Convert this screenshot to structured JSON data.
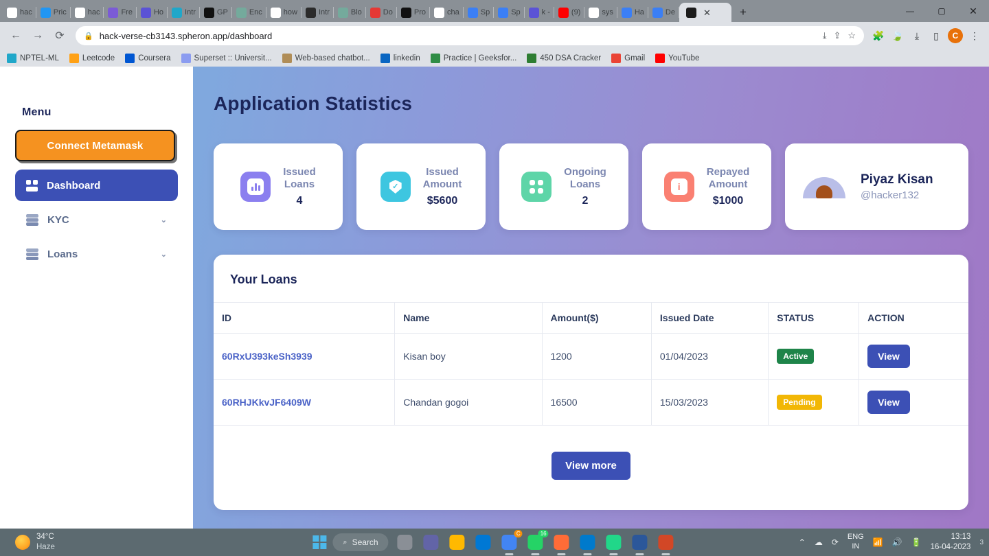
{
  "browser": {
    "tabs": [
      {
        "title": "hac",
        "icon": "github-icon",
        "color": "#ffffff"
      },
      {
        "title": "Pric",
        "icon": "bank-icon",
        "color": "#2196f3"
      },
      {
        "title": "hac",
        "icon": "google-icon",
        "color": "#ffffff"
      },
      {
        "title": "Fre",
        "icon": "office-icon",
        "color": "#7b5bd6"
      },
      {
        "title": "Ho",
        "icon": "coursera-icon",
        "color": "#5b53d6"
      },
      {
        "title": "Intr",
        "icon": "superset-icon",
        "color": "#20a7c9"
      },
      {
        "title": "GP",
        "icon": "openai-icon",
        "color": "#111111"
      },
      {
        "title": "Enc",
        "icon": "openai-icon",
        "color": "#74aa9c"
      },
      {
        "title": "how",
        "icon": "google-icon",
        "color": "#ffffff"
      },
      {
        "title": "Intr",
        "icon": "openai-dark-icon",
        "color": "#2b2b2b"
      },
      {
        "title": "Blo",
        "icon": "openai-icon",
        "color": "#74aa9c"
      },
      {
        "title": "Do",
        "icon": "heart-icon",
        "color": "#e53935"
      },
      {
        "title": "Pro",
        "icon": "globe-icon",
        "color": "#111111"
      },
      {
        "title": "cha",
        "icon": "github-icon",
        "color": "#ffffff"
      },
      {
        "title": "Sp",
        "icon": "spheron-icon",
        "color": "#3b7ff5"
      },
      {
        "title": "Sp",
        "icon": "spheron-icon",
        "color": "#3b7ff5"
      },
      {
        "title": "k -",
        "icon": "coursera-icon",
        "color": "#5b53d6"
      },
      {
        "title": "(9)",
        "icon": "youtube-icon",
        "color": "#ff0000"
      },
      {
        "title": "sys",
        "icon": "google-icon",
        "color": "#ffffff"
      },
      {
        "title": "Ha",
        "icon": "notion-blue-icon",
        "color": "#3b7ff5"
      },
      {
        "title": "De",
        "icon": "notion-blue-icon",
        "color": "#3b7ff5"
      }
    ],
    "active_tab": {
      "title": "",
      "icon": "react-icon",
      "close_label": "✕"
    },
    "new_tab_label": "+",
    "window_controls": {
      "minimize": "—",
      "maximize": "▢",
      "close": "✕"
    },
    "nav": {
      "back": "←",
      "forward": "→",
      "reload": "⟳"
    },
    "omnibox": {
      "lock_icon": "lock-icon",
      "url": "hack-verse-cb3143.spheron.app/dashboard"
    },
    "toolbar_icons": [
      "install-icon",
      "share-icon",
      "bookmark-star-icon",
      "extensions-icon",
      "leaf-icon",
      "downloads-icon",
      "sidepanel-icon"
    ],
    "profile_initial": "C",
    "menu_icon": "⋮",
    "bookmarks": [
      {
        "label": "NPTEL-ML",
        "icon": "superset-icon",
        "color": "#20a7c9"
      },
      {
        "label": "Leetcode",
        "icon": "leetcode-icon",
        "color": "#ffa116"
      },
      {
        "label": "Coursera",
        "icon": "coursera-icon",
        "color": "#0056d2"
      },
      {
        "label": "Superset :: Universit...",
        "icon": "superset-icon",
        "color": "#8b9cf0"
      },
      {
        "label": "Web-based chatbot...",
        "icon": "chatbot-icon",
        "color": "#b08d57"
      },
      {
        "label": "linkedin",
        "icon": "linkedin-icon",
        "color": "#0a66c2"
      },
      {
        "label": "Practice | Geeksfor...",
        "icon": "geeksforgeeks-icon",
        "color": "#2f8d46"
      },
      {
        "label": "450 DSA Cracker",
        "icon": "dsa-icon",
        "color": "#2e7d32"
      },
      {
        "label": "Gmail",
        "icon": "gmail-icon",
        "color": "#ea4335"
      },
      {
        "label": "YouTube",
        "icon": "youtube-icon",
        "color": "#ff0000"
      }
    ]
  },
  "sidebar": {
    "menu_title": "Menu",
    "connect_button": "Connect Metamask",
    "items": [
      {
        "label": "Dashboard",
        "icon": "grid-icon",
        "active": true,
        "chevron": ""
      },
      {
        "label": "KYC",
        "icon": "layers-icon",
        "active": false,
        "chevron": "⌄"
      },
      {
        "label": "Loans",
        "icon": "layers-icon",
        "active": false,
        "chevron": "⌄"
      }
    ]
  },
  "main": {
    "heading": "Application Statistics",
    "stats": [
      {
        "title": "Issued\nLoans",
        "title_line1": "Issued",
        "title_line2": "Loans",
        "value": "4",
        "icon": "bar-chart-icon",
        "color": "#8B7FEF"
      },
      {
        "title_line1": "Issued",
        "title_line2": "Amount",
        "value": "$5600",
        "icon": "shield-check-icon",
        "color": "#3EC6E0"
      },
      {
        "title_line1": "Ongoing",
        "title_line2": "Loans",
        "value": "2",
        "icon": "grid-four-icon",
        "color": "#5ED5A8"
      },
      {
        "title_line1": "Repayed",
        "title_line2": "Amount",
        "value": "$1000",
        "icon": "info-icon",
        "color": "#FA8072"
      }
    ],
    "user": {
      "name": "Piyaz Kisan",
      "handle": "@hacker132",
      "avatar": "user-avatar"
    },
    "loans_panel": {
      "title": "Your Loans",
      "columns": [
        "ID",
        "Name",
        "Amount($)",
        "Issued Date",
        "STATUS",
        "ACTION"
      ],
      "rows": [
        {
          "id": "60RxU393keSh3939",
          "name": "Kisan boy",
          "amount": "1200",
          "date": "01/04/2023",
          "status": "Active",
          "status_type": "active",
          "action": "View"
        },
        {
          "id": "60RHJKkvJF6409W",
          "name": "Chandan gogoi",
          "amount": "16500",
          "date": "15/03/2023",
          "status": "Pending",
          "status_type": "pending",
          "action": "View"
        }
      ],
      "view_more": "View more"
    }
  },
  "taskbar": {
    "weather": {
      "temp": "34°C",
      "condition": "Haze",
      "icon": "sun-haze-icon"
    },
    "start_icon": "windows-icon",
    "search_label": "Search",
    "apps": [
      {
        "name": "task-view-icon",
        "color": "#8a8f96"
      },
      {
        "name": "teams-icon",
        "color": "#6264a7"
      },
      {
        "name": "file-explorer-icon",
        "color": "#ffb900"
      },
      {
        "name": "edge-icon",
        "color": "#0078d4"
      },
      {
        "name": "chrome-icon",
        "color": "#4285f4",
        "badge": "C",
        "running": true
      },
      {
        "name": "whatsapp-icon",
        "color": "#25d366",
        "badge": "16",
        "running": true
      },
      {
        "name": "postman-icon",
        "color": "#ff6c37",
        "running": true
      },
      {
        "name": "vscode-icon",
        "color": "#007acc",
        "running": true
      },
      {
        "name": "pycharm-icon",
        "color": "#21d789",
        "running": true
      },
      {
        "name": "word-icon",
        "color": "#2b579a",
        "running": true
      },
      {
        "name": "powerpoint-icon",
        "color": "#d24726",
        "running": true
      }
    ],
    "tray": {
      "chevron": "⌃",
      "onedrive_icon": "cloud-icon",
      "sync_icon": "sync-icon",
      "language_line1": "ENG",
      "language_line2": "IN",
      "wifi_icon": "wifi-icon",
      "volume_icon": "speaker-icon",
      "battery_icon": "battery-icon",
      "time": "13:13",
      "date": "16-04-2023",
      "notification_count": "3"
    }
  }
}
